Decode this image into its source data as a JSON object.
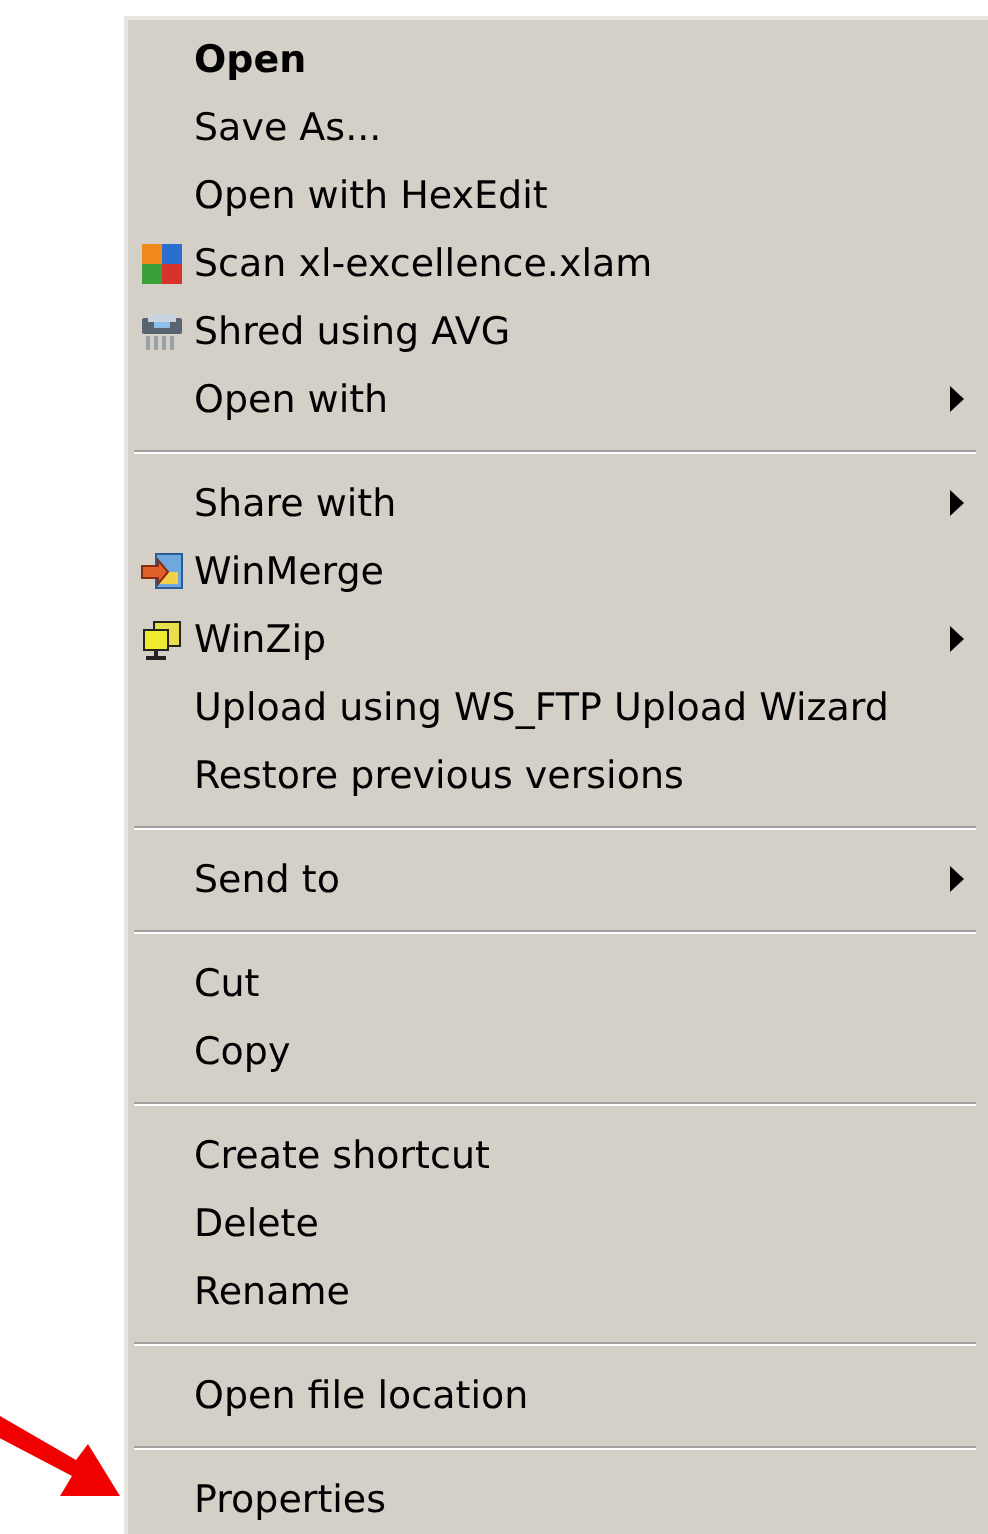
{
  "menu": {
    "groups": [
      {
        "items": [
          {
            "label": "Open",
            "default": true,
            "submenu": false
          },
          {
            "label": "Save As...",
            "default": false,
            "submenu": false
          },
          {
            "label": "Open with HexEdit",
            "default": false,
            "submenu": false
          },
          {
            "label": "Scan xl-excellence.xlam",
            "default": false,
            "submenu": false,
            "kind": "scan"
          },
          {
            "label": "Shred using AVG",
            "default": false,
            "submenu": false,
            "kind": "shred"
          },
          {
            "label": "Open with",
            "default": false,
            "submenu": true
          }
        ]
      },
      {
        "items": [
          {
            "label": "Share with",
            "default": false,
            "submenu": true
          },
          {
            "label": "WinMerge",
            "default": false,
            "submenu": false,
            "kind": "merge"
          },
          {
            "label": "WinZip",
            "default": false,
            "submenu": true,
            "kind": "zip"
          },
          {
            "label": "Upload using WS_FTP Upload Wizard",
            "default": false,
            "submenu": false
          },
          {
            "label": "Restore previous versions",
            "default": false,
            "submenu": false
          }
        ]
      },
      {
        "items": [
          {
            "label": "Send to",
            "default": false,
            "submenu": true
          }
        ]
      },
      {
        "items": [
          {
            "label": "Cut",
            "default": false,
            "submenu": false
          },
          {
            "label": "Copy",
            "default": false,
            "submenu": false
          }
        ]
      },
      {
        "items": [
          {
            "label": "Create shortcut",
            "default": false,
            "submenu": false
          },
          {
            "label": "Delete",
            "default": false,
            "submenu": false
          },
          {
            "label": "Rename",
            "default": false,
            "submenu": false
          }
        ]
      },
      {
        "items": [
          {
            "label": "Open file location",
            "default": false,
            "submenu": false
          }
        ]
      },
      {
        "items": [
          {
            "label": "Properties",
            "default": false,
            "submenu": false
          }
        ]
      }
    ]
  }
}
